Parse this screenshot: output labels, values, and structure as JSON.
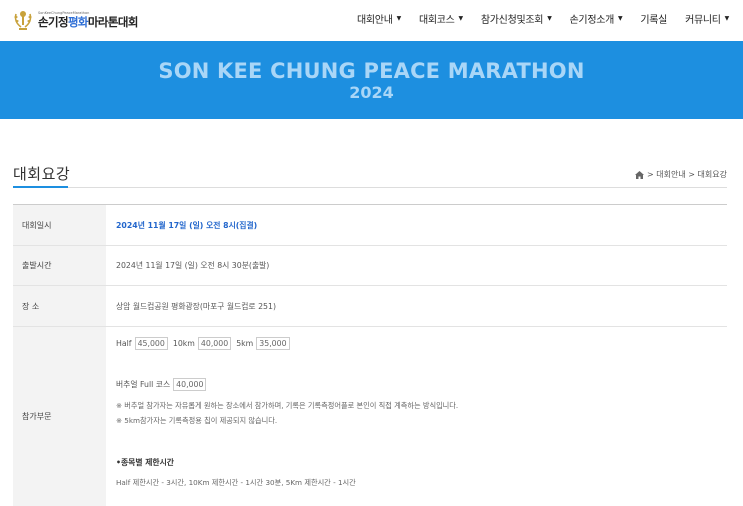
{
  "header": {
    "logo_small": "SonKeeChungPeaceMarathon",
    "logo_part1": "손기정",
    "logo_accent": "평화",
    "logo_part2": "마라톤대회",
    "nav": [
      {
        "label": "대회안내",
        "has_dropdown": true
      },
      {
        "label": "대회코스",
        "has_dropdown": true
      },
      {
        "label": "참가신청및조회",
        "has_dropdown": true
      },
      {
        "label": "손기정소개",
        "has_dropdown": true
      },
      {
        "label": "기록실",
        "has_dropdown": false
      },
      {
        "label": "커뮤니티",
        "has_dropdown": true
      }
    ]
  },
  "banner": {
    "title": "SON KEE CHUNG PEACE MARATHON",
    "year": "2024"
  },
  "page": {
    "title": "대회요강",
    "breadcrumb": [
      "대회안내",
      "대회요강"
    ]
  },
  "info": {
    "date_label": "대회일시",
    "date_value": "2024년 11월 17일 (일) 오전 8시(집결)",
    "start_label": "출발시간",
    "start_value": "2024년 11월 17일 (일) 오전 8시 30분(출발)",
    "place_label": "장 소",
    "place_value": "상암 월드컵공원 평화광장(마포구 월드컵로 251)",
    "fee_label": "참가부문",
    "fees": [
      {
        "name": "Half",
        "price": "45,000"
      },
      {
        "name": "10km",
        "price": "40,000"
      },
      {
        "name": "5km",
        "price": "35,000"
      }
    ],
    "virtual": {
      "name": "버추얼 Full 코스",
      "price": "40,000"
    },
    "note1": "※ 버추얼 참가자는 자유롭게 원하는 장소에서 참가하며, 기록은 기록측정어플로 본인이 직접 계측하는 방식입니다.",
    "note2": "※ 5km참가자는 기록측정용 칩이 제공되지 않습니다.",
    "limit_heading": "•종목별 제한시간",
    "limit_text": "Half 제한시간 - 3시간, 10Km 제한시간 - 1시간 30분,  5Km 제한시간 - 1시간"
  },
  "colors": {
    "accent": "#1d8fe0",
    "banner_text": "#a9d6f7",
    "highlight": "#2266cc",
    "logo_gold": "#c8a23c"
  },
  "icons": [
    "logo-laurel-icon",
    "caret-down-icon",
    "home-icon",
    "chevron-right-icon"
  ]
}
